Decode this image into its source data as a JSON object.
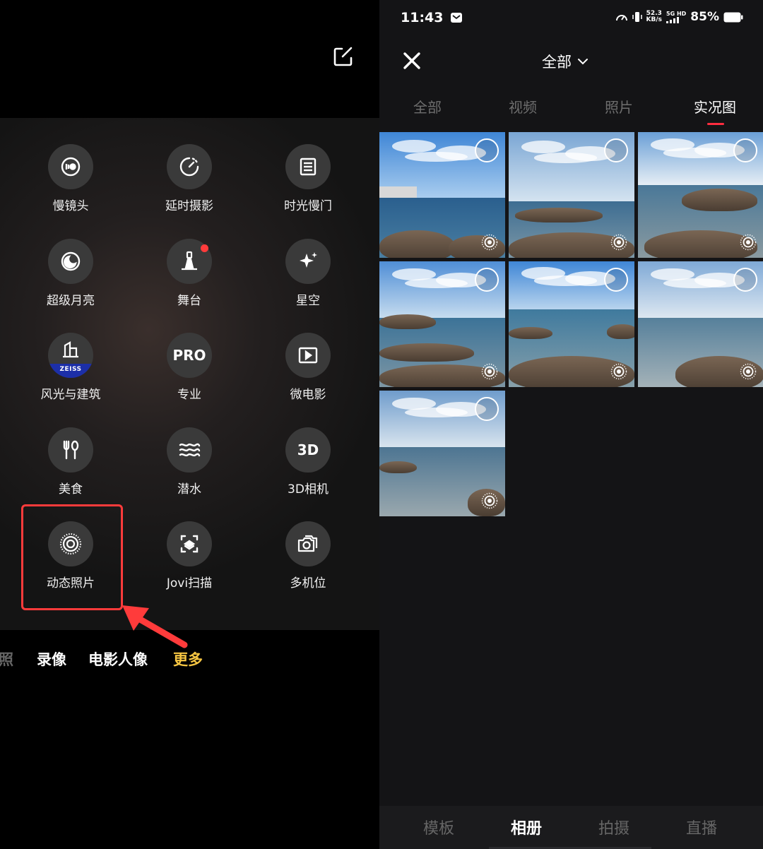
{
  "left": {
    "modes": [
      {
        "label": "慢镜头",
        "icon": "slow-motion-icon"
      },
      {
        "label": "延时摄影",
        "icon": "timelapse-icon"
      },
      {
        "label": "时光慢门",
        "icon": "slow-shutter-icon"
      },
      {
        "label": "超级月亮",
        "icon": "supermoon-icon"
      },
      {
        "label": "舞台",
        "icon": "stage-spotlight-icon",
        "has_new_dot": true
      },
      {
        "label": "星空",
        "icon": "starry-sky-icon"
      },
      {
        "label": "风光与建筑",
        "icon": "landscape-architecture-icon",
        "badge": "ZEISS"
      },
      {
        "label": "专业",
        "icon_text": "PRO"
      },
      {
        "label": "微电影",
        "icon": "micro-movie-icon"
      },
      {
        "label": "美食",
        "icon": "food-utensils-icon"
      },
      {
        "label": "潜水",
        "icon": "underwater-waves-icon"
      },
      {
        "label": "3D相机",
        "icon_text": "3D"
      },
      {
        "label": "动态照片",
        "icon": "live-photo-icon",
        "highlighted": true
      },
      {
        "label": "Jovi扫描",
        "icon": "jovi-scan-icon"
      },
      {
        "label": "多机位",
        "icon": "multi-camera-icon"
      }
    ],
    "mode_bar": {
      "partial": "照",
      "items": [
        "录像",
        "电影人像",
        "更多"
      ],
      "active": "更多"
    },
    "colors": {
      "highlight": "#ff3b3b",
      "active_mode": "#f5c542",
      "zeiss_band": "#1c2fa8"
    }
  },
  "right": {
    "status": {
      "time": "11:43",
      "net_speed_value": "52.3",
      "net_speed_unit": "KB/s",
      "signal_label": "5G HD",
      "battery": "85%"
    },
    "album_title": "全部",
    "tabs": [
      "全部",
      "视频",
      "照片",
      "实况图"
    ],
    "active_tab": "实况图",
    "photo_count": 7,
    "bottom_nav": [
      "模板",
      "相册",
      "拍摄",
      "直播"
    ],
    "active_nav": "相册",
    "colors": {
      "tab_indicator": "#ff2d3f"
    }
  }
}
